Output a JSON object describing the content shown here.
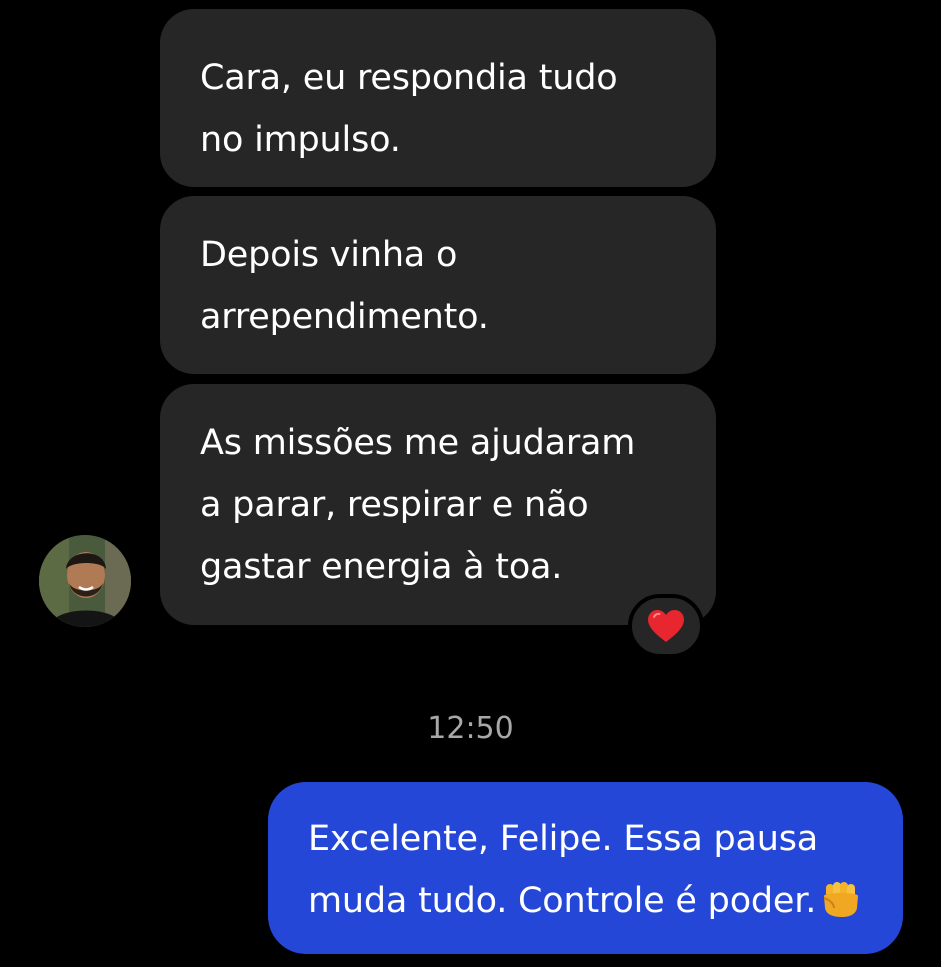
{
  "messages": {
    "incoming": [
      {
        "text": "Cara, eu respondia tudo\nno impulso."
      },
      {
        "text": "Depois vinha o\narrependimento."
      },
      {
        "text": "As missões me ajudaram\na parar, respirar e não\ngastar energia à toa."
      }
    ],
    "reaction": {
      "icon": "heart-emoji",
      "color": "#e8262f"
    },
    "timestamp": "12:50",
    "outgoing": {
      "line1": "Excelente, Felipe. Essa pausa",
      "line2": "muda tudo. Controle é poder.",
      "emoji": "fist-emoji"
    }
  },
  "colors": {
    "background": "#000000",
    "incoming_bubble": "#262626",
    "outgoing_bubble": "#2447d8",
    "timestamp_text": "#a8a8a8"
  }
}
